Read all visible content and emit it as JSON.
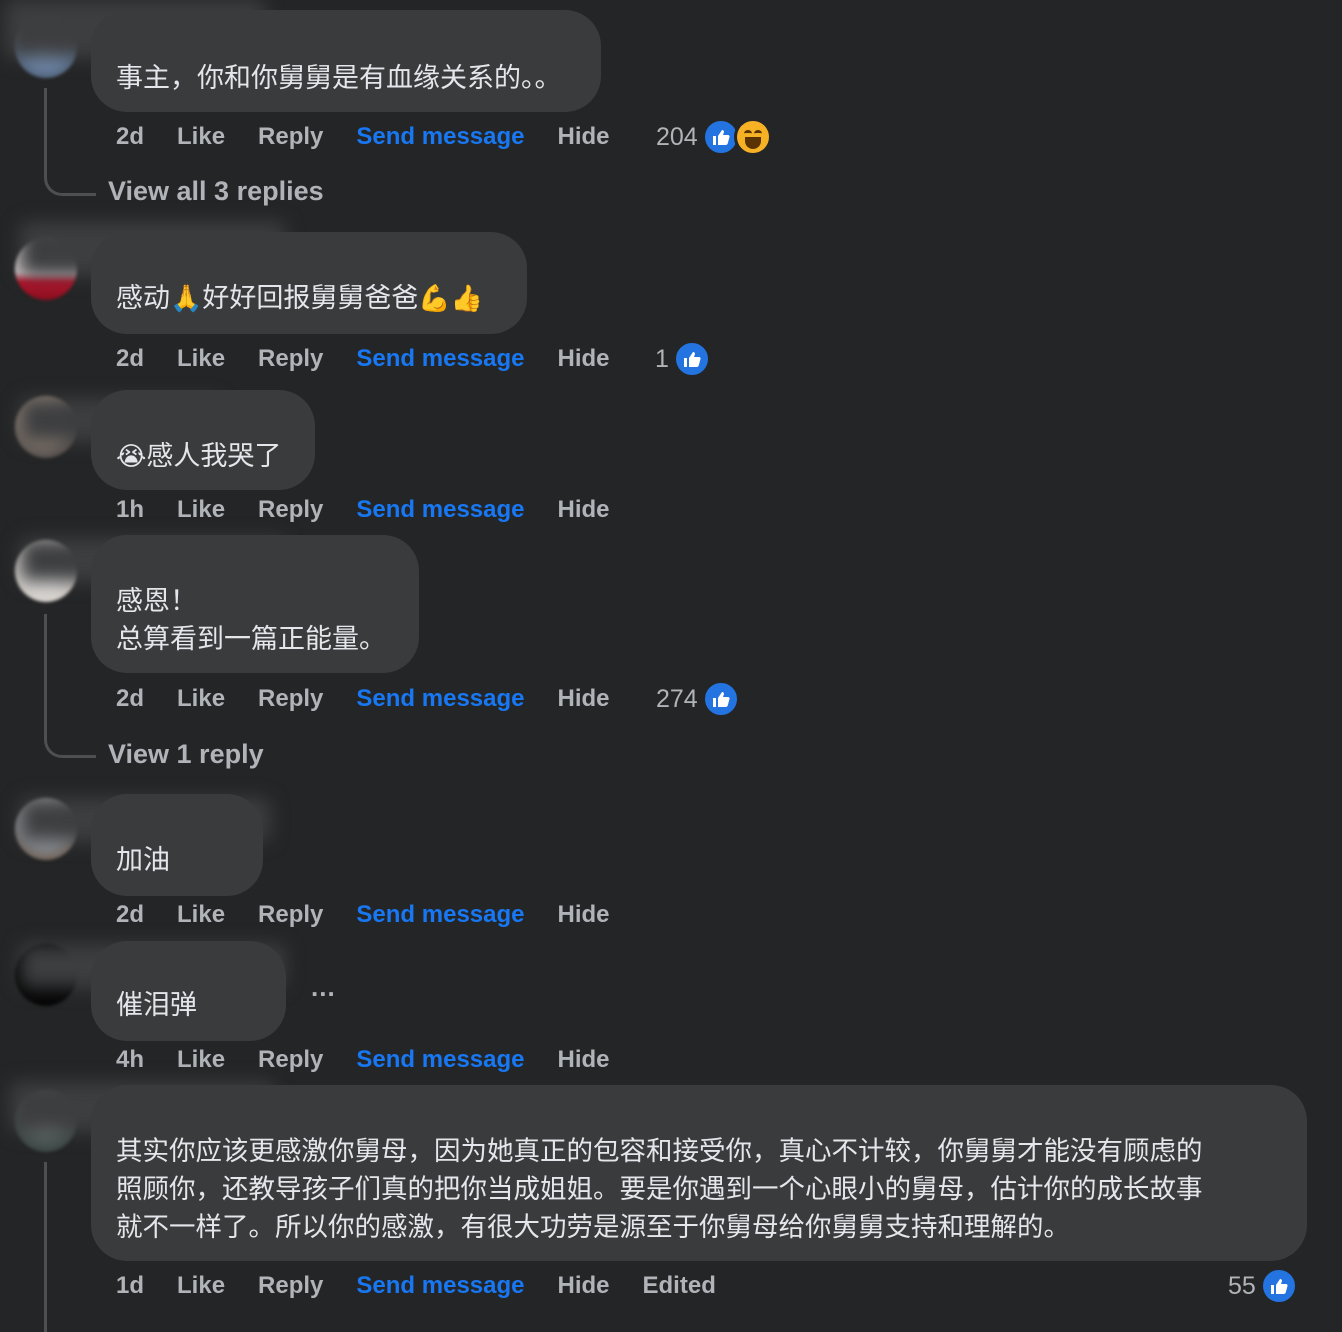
{
  "comments": [
    {
      "text": "事主，你和你舅舅是有血缘关系的。。",
      "time": "2d",
      "reactions": "204"
    },
    {
      "text_a": "感动",
      "emoji_a": "🙏",
      "text_b": "好好回报舅舅爸爸",
      "emoji_b": "💪👍",
      "time": "2d",
      "reactions": "1"
    },
    {
      "emoji": "😭",
      "text": "感人我哭了",
      "time": "1h"
    },
    {
      "text": "感恩！\n总算看到一篇正能量。",
      "time": "2d",
      "reactions": "274"
    },
    {
      "text": "加油",
      "time": "2d"
    },
    {
      "text": "催泪弹",
      "time": "4h",
      "more": "..."
    },
    {
      "text": "其实你应该更感激你舅母，因为她真正的包容和接受你，真心不计较，你舅舅才能没有顾虑的\n照顾你，还教导孩子们真的把你当成姐姐。要是你遇到一个心眼小的舅母，估计你的成长故事\n就不一样了。所以你的感激，有很大功劳是源至于你舅母给你舅舅支持和理解的。",
      "time": "1d",
      "edited": "Edited",
      "reactions": "55"
    }
  ],
  "actions": {
    "like": "Like",
    "reply": "Reply",
    "send_message": "Send message",
    "hide": "Hide"
  },
  "view_replies": [
    "View all 3 replies",
    "View 1 reply"
  ],
  "colors": {
    "background": "#242526",
    "bubble": "#3a3b3c",
    "link": "#1877f2",
    "secondary": "#b0b3b8",
    "like": "#2374e1"
  }
}
